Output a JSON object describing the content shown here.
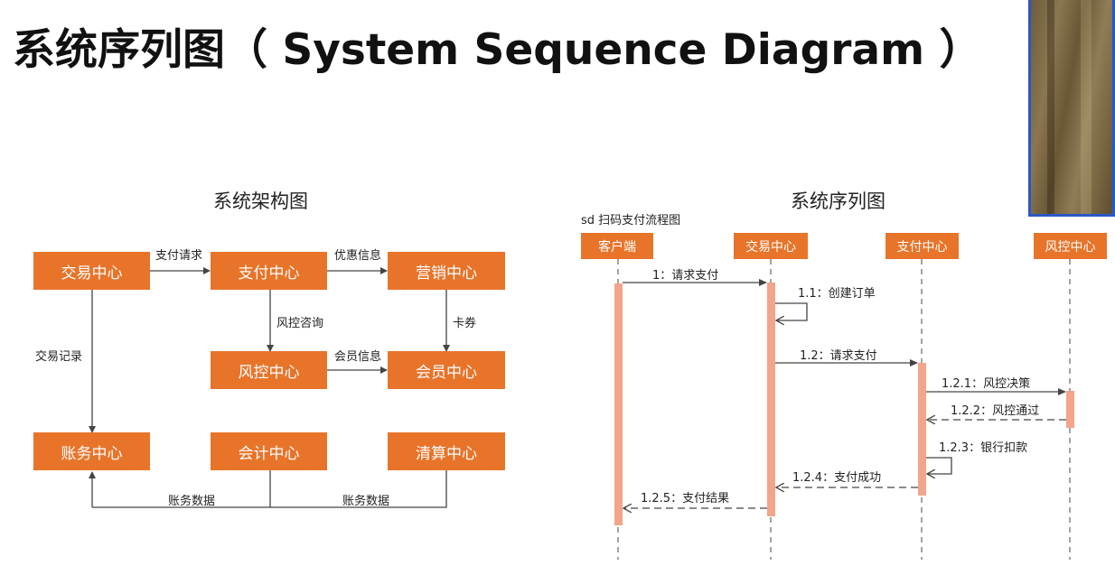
{
  "page": {
    "title": "系统序列图（ System Sequence Diagram ）"
  },
  "architecture": {
    "title": "系统架构图",
    "boxes": {
      "trade": "交易中心",
      "payment": "支付中心",
      "marketing": "营销中心",
      "risk": "风控中心",
      "member": "会员中心",
      "ledger": "账务中心",
      "accounting": "会计中心",
      "clearing": "清算中心"
    },
    "edges": {
      "pay_request": "支付请求",
      "discount_info": "优惠信息",
      "risk_consult": "风控咨询",
      "coupon": "卡券",
      "trade_record": "交易记录",
      "member_info": "会员信息",
      "ledger_data_left": "账务数据",
      "ledger_data_right": "账务数据"
    }
  },
  "sequence": {
    "title": "系统序列图",
    "frame_label": "sd 扫码支付流程图",
    "lifelines": [
      "客户端",
      "交易中心",
      "支付中心",
      "风控中心"
    ],
    "messages": {
      "m1": "1：请求支付",
      "m11": "1.1：创建订单",
      "m12": "1.2：请求支付",
      "m121": "1.2.1：风控决策",
      "m122": "1.2.2：风控通过",
      "m123": "1.2.3：银行扣款",
      "m124": "1.2.4：支付成功",
      "m125": "1.2.5：支付结果"
    }
  }
}
